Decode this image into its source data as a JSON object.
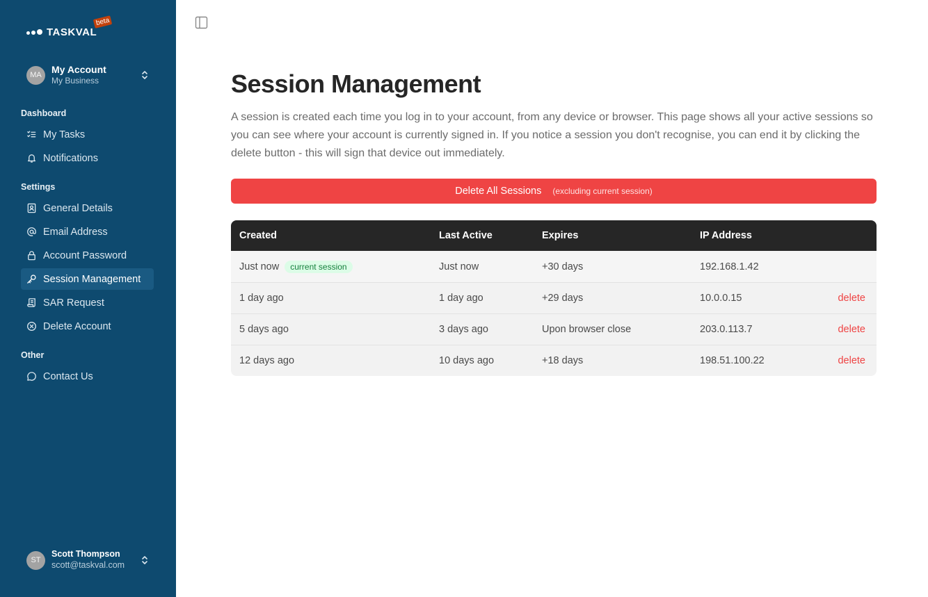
{
  "brand": {
    "name": "TASKVAL",
    "badge": "beta"
  },
  "account": {
    "initials": "MA",
    "name": "My Account",
    "business": "My Business"
  },
  "sections": {
    "dashboard": "Dashboard",
    "settings": "Settings",
    "other": "Other"
  },
  "nav": {
    "my_tasks": "My Tasks",
    "notifications": "Notifications",
    "general_details": "General Details",
    "email_address": "Email Address",
    "account_password": "Account Password",
    "session_management": "Session Management",
    "sar_request": "SAR Request",
    "delete_account": "Delete Account",
    "contact_us": "Contact Us"
  },
  "user": {
    "initials": "ST",
    "name": "Scott Thompson",
    "email": "scott@taskval.com"
  },
  "page": {
    "title": "Session Management",
    "description": "A session is created each time you log in to your account, from any device or browser. This page shows all your active sessions so you can see where your account is currently signed in. If you notice a session you don't recognise, you can end it by clicking the delete button - this will sign that device out immediately."
  },
  "delete_all": {
    "label": "Delete All Sessions",
    "note": "(excluding current session)"
  },
  "table": {
    "headers": {
      "created": "Created",
      "last_active": "Last Active",
      "expires": "Expires",
      "ip": "IP Address"
    },
    "rows": [
      {
        "created": "Just now",
        "badge": "current session",
        "last_active": "Just now",
        "expires": "+30 days",
        "ip": "192.168.1.42"
      },
      {
        "created": "1 day ago",
        "last_active": "1 day ago",
        "expires": "+29 days",
        "ip": "10.0.0.15",
        "action": "delete"
      },
      {
        "created": "5 days ago",
        "last_active": "3 days ago",
        "expires": "Upon browser close",
        "ip": "203.0.113.7",
        "action": "delete"
      },
      {
        "created": "12 days ago",
        "last_active": "10 days ago",
        "expires": "+18 days",
        "ip": "198.51.100.22",
        "action": "delete"
      }
    ]
  },
  "colors": {
    "sidebar": "#0e4a6f",
    "sidebar_active": "#1a5a82",
    "danger": "#ef4444",
    "table_header": "#262626",
    "badge_bg": "#dcfce7",
    "badge_text": "#15803d"
  }
}
